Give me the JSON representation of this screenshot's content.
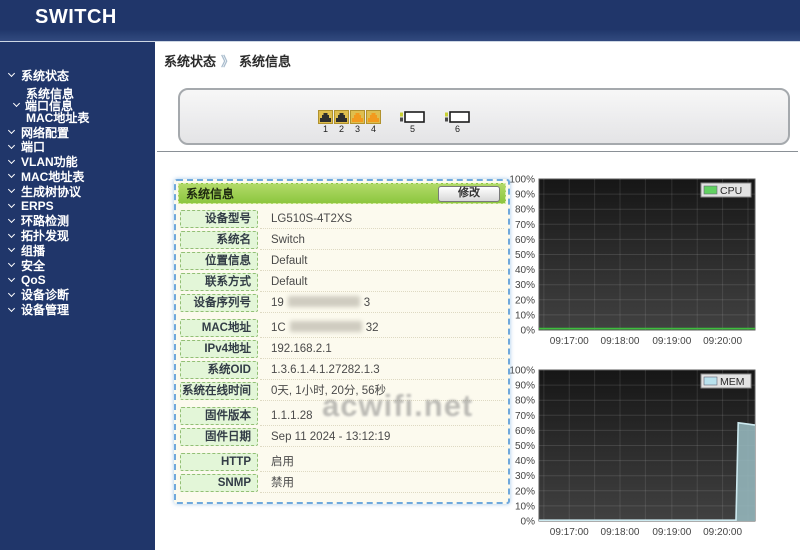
{
  "app": {
    "logo": "SWITCH"
  },
  "breadcrumb": {
    "parent": "系统状态",
    "separator": "》",
    "current": "系统信息"
  },
  "sidebar": {
    "items": [
      {
        "label": "系统状态",
        "expanded": true,
        "children": [
          {
            "label": "系统信息",
            "active": true
          },
          {
            "label": "端口信息",
            "chevron": true
          },
          {
            "label": "MAC地址表"
          }
        ]
      },
      {
        "label": "网络配置"
      },
      {
        "label": "端口"
      },
      {
        "label": "VLAN功能"
      },
      {
        "label": "MAC地址表"
      },
      {
        "label": "生成树协议"
      },
      {
        "label": "ERPS"
      },
      {
        "label": "环路检测"
      },
      {
        "label": "拓扑发现"
      },
      {
        "label": "组播"
      },
      {
        "label": "安全"
      },
      {
        "label": "QoS"
      },
      {
        "label": "设备诊断"
      },
      {
        "label": "设备管理"
      }
    ]
  },
  "device_panel": {
    "ports": [
      {
        "num": "1",
        "kind": "rj45",
        "state": "dark"
      },
      {
        "num": "2",
        "kind": "rj45",
        "state": "dark"
      },
      {
        "num": "3",
        "kind": "rj45",
        "state": "orange"
      },
      {
        "num": "4",
        "kind": "rj45",
        "state": "orange"
      },
      {
        "num": "5",
        "kind": "sfp"
      },
      {
        "num": "6",
        "kind": "sfp"
      }
    ]
  },
  "info_panel": {
    "title": "系统信息",
    "modify_button": "修改",
    "groups": [
      {
        "rows": [
          {
            "label": "设备型号",
            "value": "LG510S-4T2XS"
          },
          {
            "label": "系统名",
            "value": "Switch"
          },
          {
            "label": "位置信息",
            "value": "Default"
          },
          {
            "label": "联系方式",
            "value": "Default"
          },
          {
            "label": "设备序列号",
            "redacted": true,
            "value_prefix": "19",
            "value_suffix": "3"
          }
        ]
      },
      {
        "rows": [
          {
            "label": "MAC地址",
            "redacted": true,
            "value_prefix": "1C",
            "value_suffix": "32"
          },
          {
            "label": "IPv4地址",
            "value": "192.168.2.1"
          },
          {
            "label": "系统OID",
            "value": "1.3.6.1.4.1.27282.1.3"
          },
          {
            "label": "系统在线时间",
            "value": "0天, 1小时, 20分, 56秒"
          }
        ]
      },
      {
        "rows": [
          {
            "label": "固件版本",
            "value": "1.1.1.28"
          },
          {
            "label": "固件日期",
            "value": "Sep 11 2024 - 13:12:19"
          }
        ]
      },
      {
        "rows": [
          {
            "label": "HTTP",
            "value": "启用"
          },
          {
            "label": "SNMP",
            "value": "禁用"
          }
        ]
      }
    ]
  },
  "watermark": "acwifi.net",
  "chart_data": [
    {
      "type": "area",
      "title": "CPU usage",
      "legend": "CPU",
      "legend_position": "top-right",
      "grid": true,
      "ylim": [
        0,
        100
      ],
      "y_tick_labels": [
        "100%",
        "90%",
        "80%",
        "70%",
        "60%",
        "50%",
        "40%",
        "30%",
        "20%",
        "10%",
        "0%"
      ],
      "x_tick_labels": [
        "09:17:00",
        "09:18:00",
        "09:19:00",
        "09:20:00"
      ],
      "x_tick_fractions": [
        0.14,
        0.375,
        0.615,
        0.85
      ],
      "line_color": "#3dbd3d",
      "fill_color": "rgba(61,189,61,0.25)",
      "legend_swatch_color": "#62d162",
      "points": [
        {
          "x": 0,
          "y": 1
        },
        {
          "x": 1,
          "y": 1
        }
      ]
    },
    {
      "type": "area",
      "title": "Memory usage",
      "legend": "MEM",
      "legend_position": "top-right",
      "grid": true,
      "ylim": [
        0,
        100
      ],
      "y_tick_labels": [
        "100%",
        "90%",
        "80%",
        "70%",
        "60%",
        "50%",
        "40%",
        "30%",
        "20%",
        "10%",
        "0%"
      ],
      "x_tick_labels": [
        "09:17:00",
        "09:18:00",
        "09:19:00",
        "09:20:00"
      ],
      "x_tick_fractions": [
        0.14,
        0.375,
        0.615,
        0.85
      ],
      "line_color": "#cdeaf0",
      "fill_color": "rgba(150,184,190,0.88)",
      "legend_swatch_color": "#b9e2ed",
      "points": [
        {
          "x": 0,
          "y": 0.5
        },
        {
          "x": 0.912,
          "y": 0.5
        },
        {
          "x": 0.922,
          "y": 65
        },
        {
          "x": 0.95,
          "y": 64.5
        },
        {
          "x": 1,
          "y": 63.5
        }
      ]
    }
  ],
  "colors": {
    "navy": "#20366a",
    "header_green": "#8cc63f",
    "label_cell_green": "#e3f6d8",
    "panel_cream": "#fcfaee",
    "panel_border_blue": "#6fa8dc",
    "cpu_green": "#3dbd3d",
    "mem_blue": "#b9e2ed",
    "plot_bg_top": "#161616",
    "plot_bg_bottom": "#414141"
  }
}
